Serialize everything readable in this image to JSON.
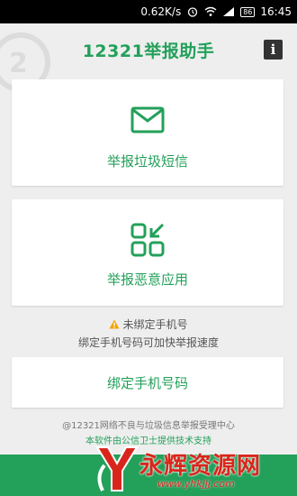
{
  "status_bar": {
    "speed": "0.62K/s",
    "battery": "86",
    "time": "16:45"
  },
  "header": {
    "title": "12321举报助手",
    "info_icon_label": "i"
  },
  "cards": {
    "sms": {
      "label": "举报垃圾短信",
      "icon": "envelope-icon"
    },
    "app": {
      "label": "举报恶意应用",
      "icon": "app-grid-icon"
    },
    "bind": {
      "label": "绑定手机号码"
    }
  },
  "notice": {
    "warning_text": "未绑定手机号",
    "hint_text": "绑定手机号码可加快举报速度"
  },
  "footer": {
    "org": "@12321网络不良与垃圾信息举报受理中心",
    "support": "本软件由公信卫士提供技术支持"
  },
  "watermark": {
    "name": "永辉资源网",
    "url": "www.yhkjjj.com"
  },
  "colors": {
    "accent": "#23a05a",
    "background": "#eeeeee",
    "warning": "#f2a400",
    "watermark": "#d9261c"
  }
}
